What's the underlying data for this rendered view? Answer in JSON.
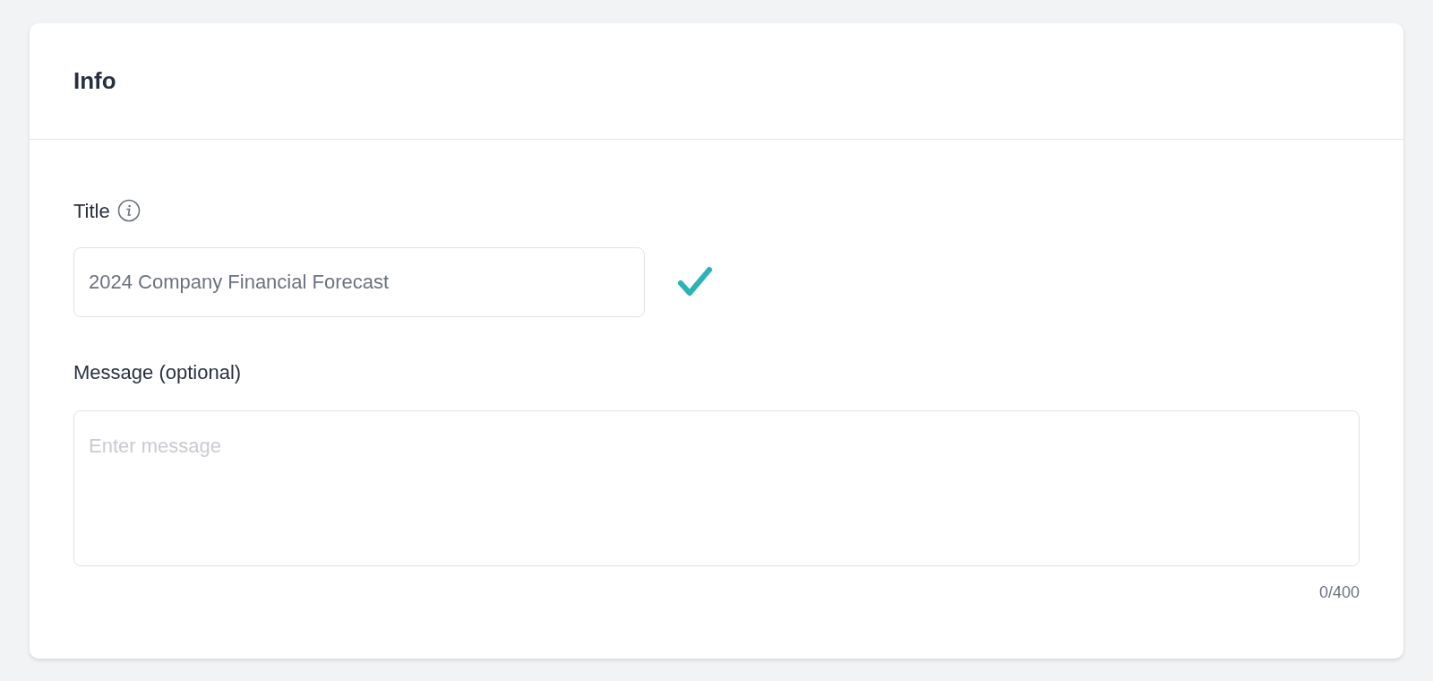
{
  "card": {
    "title": "Info"
  },
  "fields": [
    {
      "kind": "input",
      "label": "Title",
      "info": true,
      "value": "2024 Company Financial Forecast",
      "valid": true
    },
    {
      "kind": "textarea",
      "label": "Message (optional)",
      "info": false,
      "placeholder": "Enter message",
      "counter": "0/400"
    }
  ]
}
